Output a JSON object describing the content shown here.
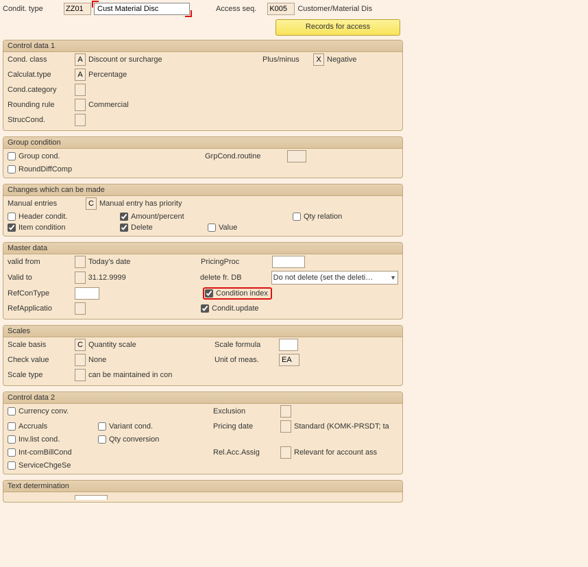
{
  "header": {
    "condit_type_label": "Condit. type",
    "condit_type_code": "ZZ01",
    "condit_type_desc": "Cust Material Disc",
    "access_seq_label": "Access seq.",
    "access_seq_code": "K005",
    "access_seq_desc": "Customer/Material Dis",
    "records_btn": "Records for access"
  },
  "control1": {
    "title": "Control data 1",
    "cond_class_label": "Cond. class",
    "cond_class_code": "A",
    "cond_class_desc": "Discount or surcharge",
    "plus_minus_label": "Plus/minus",
    "plus_minus_code": "X",
    "plus_minus_desc": "Negative",
    "calc_type_label": "Calculat.type",
    "calc_type_code": "A",
    "calc_type_desc": "Percentage",
    "cond_category_label": "Cond.category",
    "rounding_label": "Rounding rule",
    "rounding_desc": "Commercial",
    "struccond_label": "StrucCond."
  },
  "group": {
    "title": "Group condition",
    "group_cond": "Group cond.",
    "grp_routine": "GrpCond.routine",
    "rounddiff": "RoundDiffComp"
  },
  "changes": {
    "title": "Changes which can be made",
    "manual_entries_label": "Manual entries",
    "manual_entries_code": "C",
    "manual_entries_desc": "Manual entry has priority",
    "header_condit": "Header condit.",
    "amount_percent": "Amount/percent",
    "qty_relation": "Qty relation",
    "item_condition": "Item condition",
    "delete": "Delete",
    "value": "Value"
  },
  "master": {
    "title": "Master data",
    "valid_from_label": "valid from",
    "valid_from_desc": "Today's date",
    "pricing_proc": "PricingProc",
    "valid_to_label": "Valid to",
    "valid_to_desc": "31.12.9999",
    "delete_db_label": "delete fr. DB",
    "delete_db_value": "Do not delete (set the deleti…",
    "refcontype_label": "RefConType",
    "condition_index": "Condition index",
    "refapp_label": "RefApplicatio",
    "condit_update": "Condit.update"
  },
  "scales": {
    "title": "Scales",
    "scale_basis_label": "Scale basis",
    "scale_basis_code": "C",
    "scale_basis_desc": "Quantity scale",
    "scale_formula": "Scale formula",
    "check_value_label": "Check value",
    "check_value_desc": "None",
    "unit_label": "Unit of meas.",
    "unit_code": "EA",
    "scale_type_label": "Scale type",
    "scale_type_desc": "can be maintained in con"
  },
  "control2": {
    "title": "Control data 2",
    "currency_conv": "Currency conv.",
    "exclusion": "Exclusion",
    "accruals": "Accruals",
    "variant_cond": "Variant cond.",
    "pricing_date_label": "Pricing date",
    "pricing_date_desc": "Standard (KOMK-PRSDT; ta",
    "invlist": "Inv.list cond.",
    "qty_conv": "Qty conversion",
    "intcom": "Int-comBillCond",
    "relacc_label": "Rel.Acc.Assig",
    "relacc_desc": "Relevant for account ass",
    "servicechg": "ServiceChgeSe"
  },
  "text_det": {
    "title": "Text determination"
  }
}
